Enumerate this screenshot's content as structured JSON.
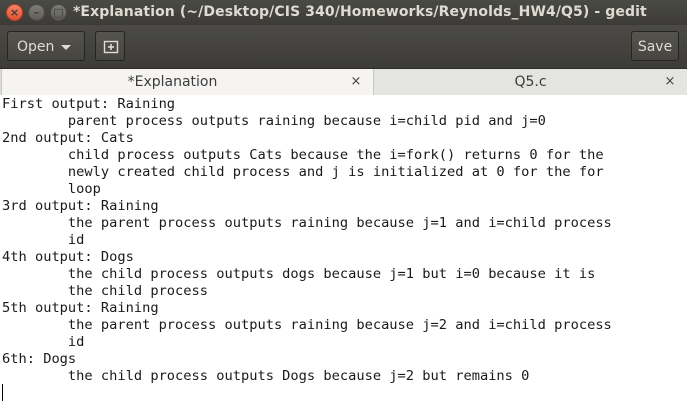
{
  "window": {
    "title": "*Explanation (~/Desktop/CIS 340/Homeworks/Reynolds_HW4/Q5) - gedit",
    "close_glyph": "×",
    "minimize_glyph": "–",
    "maximize_glyph": "□"
  },
  "toolbar": {
    "open_label": "Open",
    "save_label": "Save"
  },
  "tabs": [
    {
      "label": "*Explanation",
      "close_glyph": "×",
      "active": true
    },
    {
      "label": "Q5.c",
      "close_glyph": "×",
      "active": false
    }
  ],
  "editor": {
    "lines": [
      "First output: Raining",
      "        parent process outputs raining because i=child pid and j=0",
      "2nd output: Cats",
      "        child process outputs Cats because the i=fork() returns 0 for the",
      "        newly created child process and j is initialized at 0 for the for",
      "        loop",
      "3rd output: Raining",
      "        the parent process outputs raining because j=1 and i=child process",
      "        id",
      "4th output: Dogs",
      "        the child process outputs dogs because j=1 but i=0 because it is",
      "        the child process",
      "5th output: Raining",
      "        the parent process outputs raining because j=2 and i=child process",
      "        id",
      "6th: Dogs",
      "        the child process outputs Dogs because j=2 but remains 0"
    ]
  },
  "colors": {
    "titlebar": "#3c3b37",
    "close_button": "#e0532f",
    "tabbar": "#dcdcd8",
    "editor_bg": "#ffffff"
  }
}
